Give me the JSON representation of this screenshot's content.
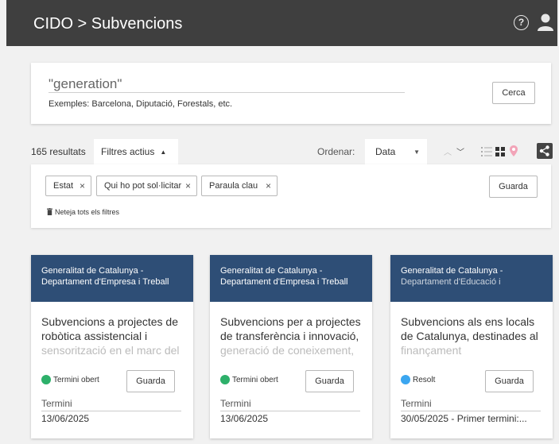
{
  "header": {
    "title": "CIDO > Subvencions",
    "help_icon": "question-circle-icon",
    "user_icon": "user-icon"
  },
  "search": {
    "value": "\"generation\"",
    "examples": "Exemples: Barcelona, Diputació, Forestals, etc.",
    "button_label": "Cerca"
  },
  "toolbar": {
    "results_count": "165 resultats",
    "filters_tab_label": "Filtres actius",
    "order_label": "Ordenar:",
    "order_value": "Data"
  },
  "filters": {
    "chips": [
      {
        "label": "Estat"
      },
      {
        "label": "Qui ho pot sol·licitar"
      },
      {
        "label": "Paraula clau"
      }
    ],
    "save_label": "Guarda",
    "clear_label": "Neteja tots els filtres"
  },
  "cards": [
    {
      "org_line1": "Generalitat de Catalunya -",
      "org_line2": "Departament d'Empresa i Treball",
      "title_line1": "Subvencions a projectes de",
      "title_line2": "robòtica assistencial i",
      "title_line3": "sensorització en el marc del",
      "status": "Termini obert",
      "status_color": "#2db06a",
      "save_label": "Guarda",
      "deadline_label": "Termini",
      "deadline_value": "13/06/2025"
    },
    {
      "org_line1": "Generalitat de Catalunya -",
      "org_line2": "Departament d'Empresa i Treball",
      "title_line1": "Subvencions per a projectes",
      "title_line2": "de transferència i innovació,",
      "title_line3": "generació de coneixement,",
      "status": "Termini obert",
      "status_color": "#2db06a",
      "save_label": "Guarda",
      "deadline_label": "Termini",
      "deadline_value": "13/06/2025"
    },
    {
      "org_line1": "Generalitat de Catalunya -",
      "org_line2": "Departament d'Educació i",
      "title_line1": "Subvencions als ens locals",
      "title_line2": "de Catalunya, destinades al",
      "title_line3": "finançament",
      "status": "Resolt",
      "status_color": "#3ba6f0",
      "save_label": "Guarda",
      "deadline_label": "Termini",
      "deadline_value": "30/05/2025 - Primer termini:..."
    }
  ],
  "colors": {
    "topbar": "#3f3f3f",
    "card_header": "#2e4e76",
    "background": "#f1f1f1"
  }
}
